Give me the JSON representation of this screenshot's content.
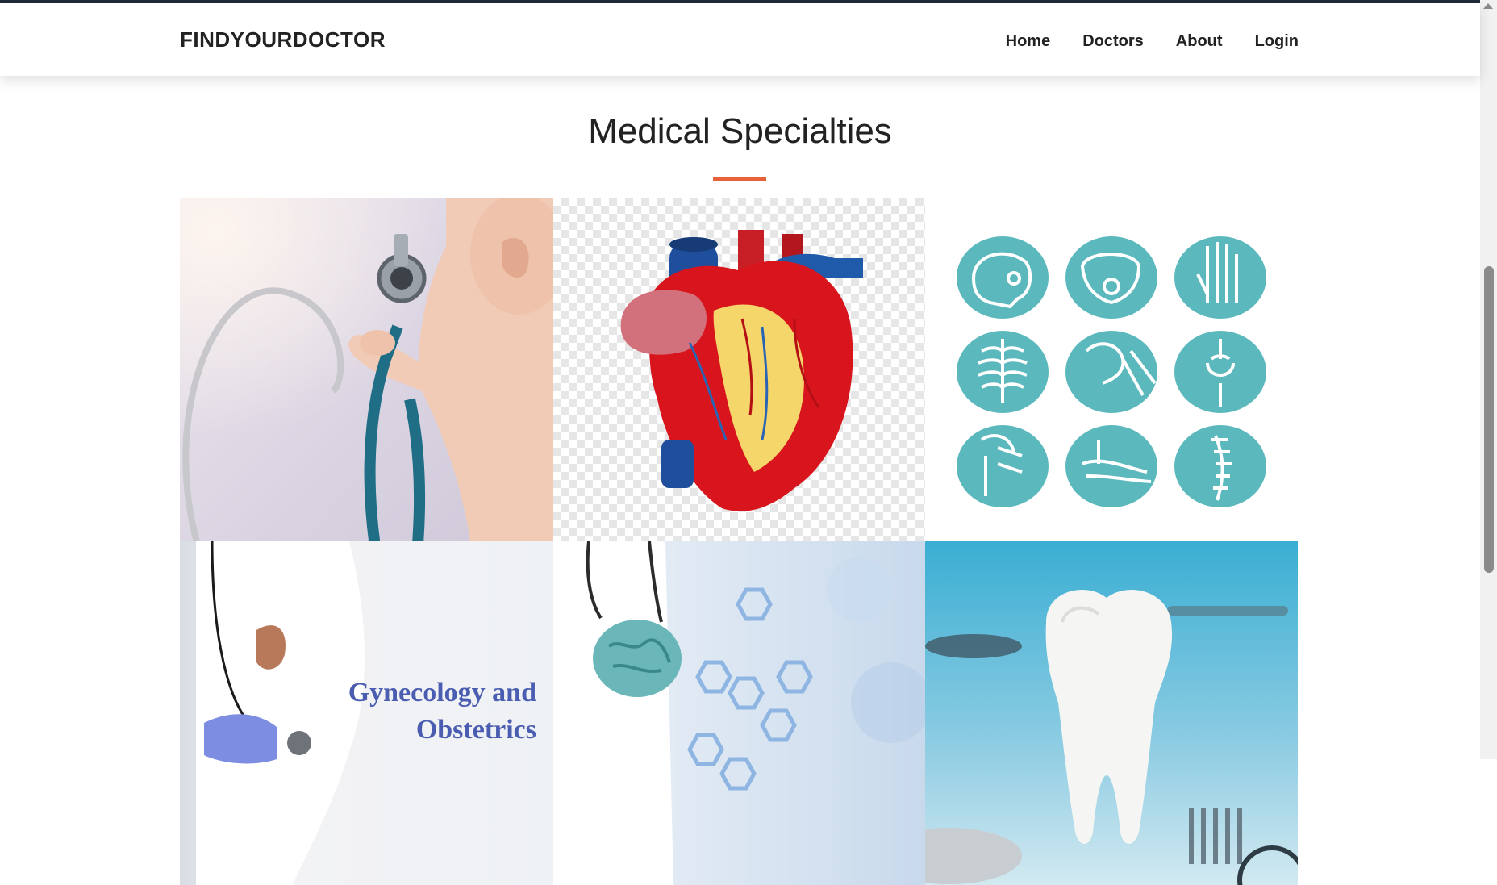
{
  "header": {
    "brand": "FINDYOURDOCTOR",
    "nav": [
      {
        "label": "Home"
      },
      {
        "label": "Doctors"
      },
      {
        "label": "About"
      },
      {
        "label": "Login"
      }
    ]
  },
  "section": {
    "title": "Medical Specialties"
  },
  "cards": [
    {
      "image": "pediatrics-baby-stethoscope-image"
    },
    {
      "image": "cardiology-heart-image"
    },
    {
      "image": "orthopedics-bones-icons-image"
    },
    {
      "image": "gynecology-obstetrics-image",
      "text_line1": "Gynecology and",
      "text_line2": "Obstetrics"
    },
    {
      "image": "neurology-brain-image"
    },
    {
      "image": "dentistry-tooth-image"
    }
  ],
  "colors": {
    "accent": "#e7623a",
    "teal": "#5bb9bd",
    "gyn_text": "#4a5db0"
  }
}
